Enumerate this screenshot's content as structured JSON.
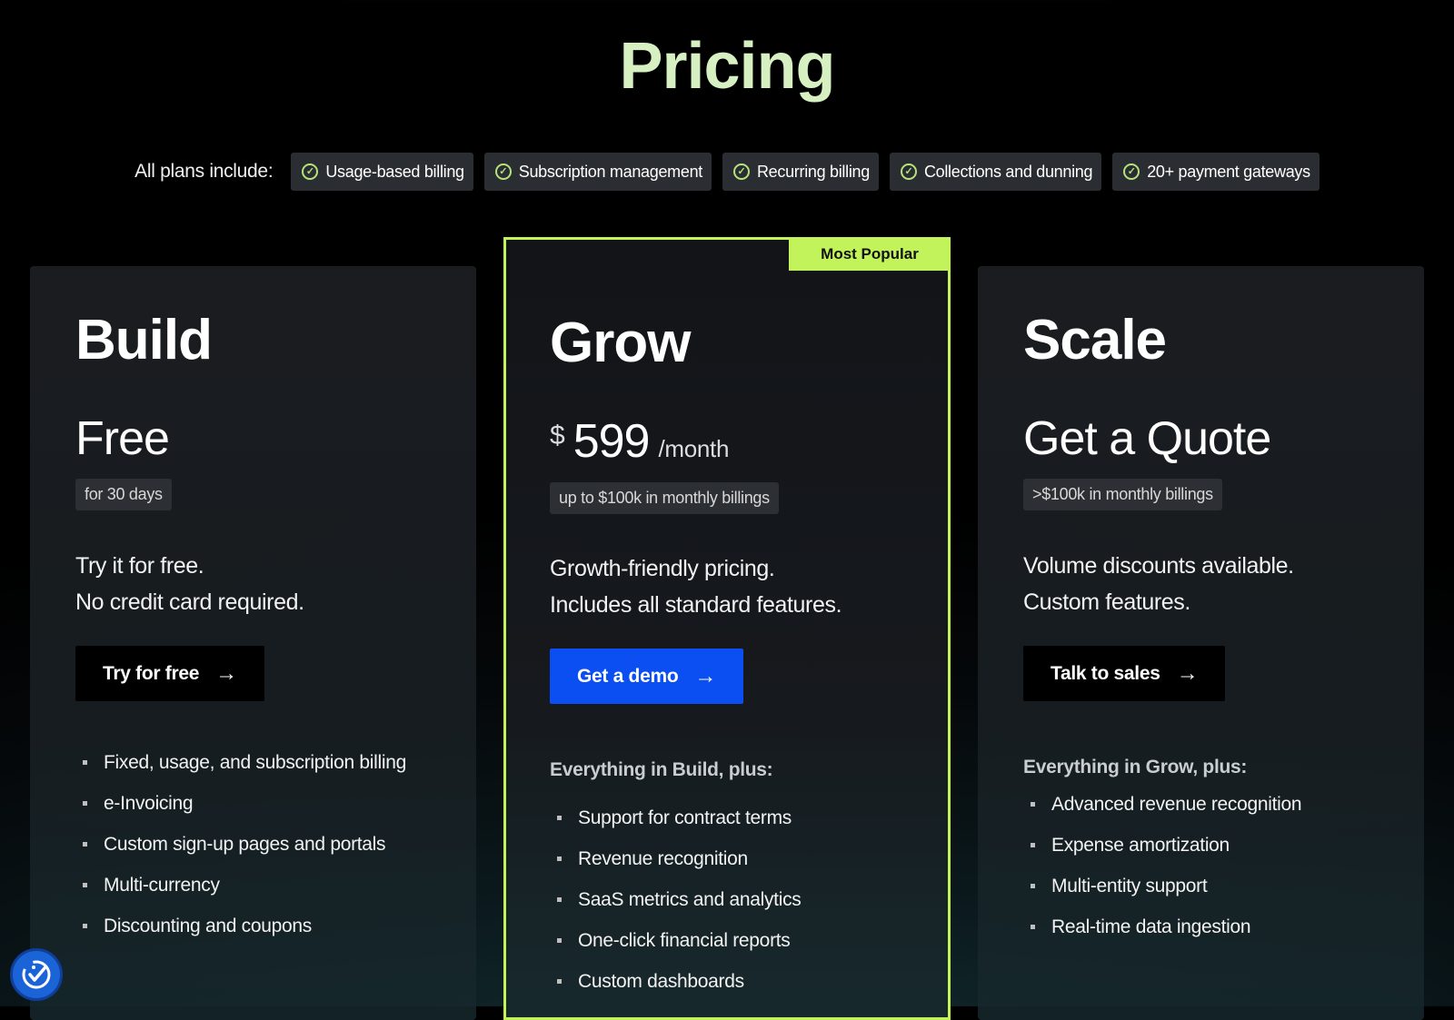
{
  "page": {
    "title": "Pricing"
  },
  "includes": {
    "label": "All plans include:",
    "items": [
      "Usage-based billing",
      "Subscription management",
      "Recurring billing",
      "Collections and dunning",
      "20+ payment gateways"
    ]
  },
  "plans": [
    {
      "name": "Build",
      "price": "Free",
      "tag": "for 30 days",
      "desc_line1": "Try it for free.",
      "desc_line2": "No credit card required.",
      "cta": "Try for free",
      "features": [
        "Fixed, usage, and subscription billing",
        "e-Invoicing",
        "Custom sign-up pages and portals",
        "Multi-currency",
        "Discounting and coupons"
      ]
    },
    {
      "name": "Grow",
      "badge": "Most Popular",
      "currency": "$",
      "price": "599",
      "period": "/month",
      "tag": "up to $100k in monthly billings",
      "desc_line1": "Growth-friendly pricing.",
      "desc_line2": "Includes all standard features.",
      "cta": "Get a demo",
      "features_heading": "Everything in Build, plus:",
      "features": [
        "Support for contract terms",
        "Revenue recognition",
        "SaaS metrics and analytics",
        "One-click financial reports",
        "Custom dashboards"
      ]
    },
    {
      "name": "Scale",
      "price": "Get a Quote",
      "tag": ">$100k in monthly billings",
      "desc_line1": "Volume discounts available.",
      "desc_line2": "Custom features.",
      "cta": "Talk to sales",
      "features_heading": "Everything in Grow, plus:",
      "features": [
        "Advanced revenue recognition",
        "Expense amortization",
        "Multi-entity support",
        "Real-time data ingestion"
      ]
    }
  ],
  "icons": {
    "check": "check-circle-icon",
    "arrow": "arrow-right-icon",
    "accessibility": "accessibility-icon"
  },
  "colors": {
    "accent": "#c2f35b",
    "title": "#d7f0c2",
    "primary_button": "#0b4ff2",
    "background": "#000000"
  }
}
